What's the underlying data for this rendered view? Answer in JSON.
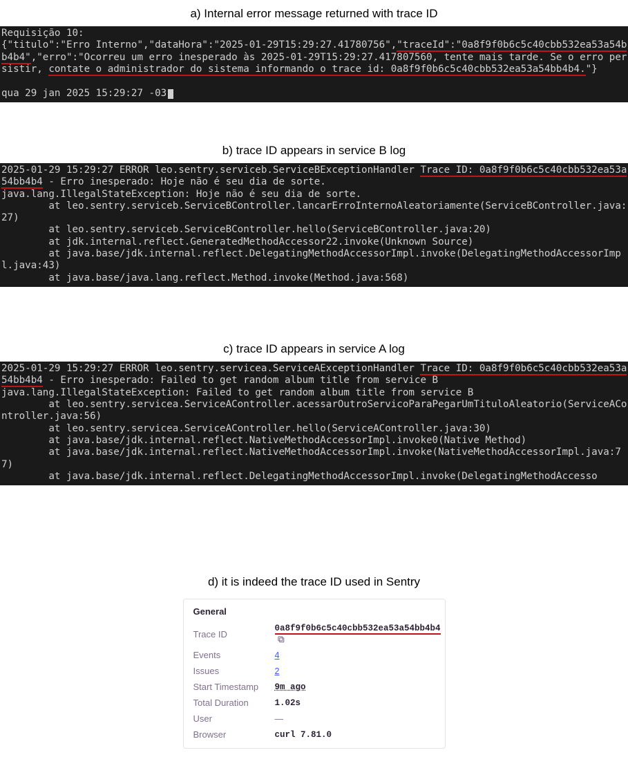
{
  "captions": {
    "a": "a) Internal error message returned with trace ID",
    "b": "b) trace ID appears in service B log",
    "c": "c) trace ID appears in service A log",
    "d": "d) it is indeed the trace ID used in Sentry"
  },
  "panelA": {
    "line1_pre": "Requisição 10:",
    "json_open": "{\"titulo\":\"Erro Interno\",\"dataHora\":\"2025-01-29T15:29:27.41780756\",",
    "json_trace_key": "\"traceId\":\"0a8f9f0b6c5c40cbb532ea53a54bb4b4\"",
    "json_mid": ",\"erro\":\"Ocorreu um erro inesperado às 2025-01-29T15:29:27.417807560, tente mais tarde. Se o erro persistir, ",
    "json_contact": "contate o administrador do sistema informando o trace id: 0a8f9f0b6c5c40cbb532ea53a54bb4b4.",
    "json_close": "\"}",
    "ts": "qua 29 jan 2025 15:29:27 -03"
  },
  "panelB": {
    "head_pre": "2025-01-29 15:29:27 ERROR leo.sentry.serviceb.ServiceBExceptionHandler ",
    "trace": "Trace ID: 0a8f9f0b6c5c40cbb532ea53a54bb4b4",
    "head_post": " - Erro inesperado: Hoje não é seu dia de sorte.",
    "stack": "java.lang.IllegalStateException: Hoje não é seu dia de sorte.\n        at leo.sentry.serviceb.ServiceBController.lancarErroInternoAleatoriamente(ServiceBController.java:27)\n        at leo.sentry.serviceb.ServiceBController.hello(ServiceBController.java:20)\n        at jdk.internal.reflect.GeneratedMethodAccessor22.invoke(Unknown Source)\n        at java.base/jdk.internal.reflect.DelegatingMethodAccessorImpl.invoke(DelegatingMethodAccessorImpl.java:43)\n        at java.base/java.lang.reflect.Method.invoke(Method.java:568)"
  },
  "panelC": {
    "head_pre": "2025-01-29 15:29:27 ERROR leo.sentry.servicea.ServiceAExceptionHandler ",
    "trace": "Trace ID: 0a8f9f0b6c5c40cbb532ea53a54bb4b4",
    "head_post": " - Erro inesperado: Failed to get random album title from service B",
    "stack": "java.lang.IllegalStateException: Failed to get random album title from service B\n        at leo.sentry.servicea.ServiceAController.acessarOutroServicoParaPegarUmTituloAleatorio(ServiceAController.java:56)\n        at leo.sentry.servicea.ServiceAController.hello(ServiceAController.java:30)\n        at java.base/jdk.internal.reflect.NativeMethodAccessorImpl.invoke0(Native Method)\n        at java.base/jdk.internal.reflect.NativeMethodAccessorImpl.invoke(NativeMethodAccessorImpl.java:77)\n        at java.base/jdk.internal.reflect.DelegatingMethodAccessorImpl.invoke(DelegatingMethodAccesso"
  },
  "sentry": {
    "title": "General",
    "rows": {
      "traceIdLabel": "Trace ID",
      "traceIdValue": "0a8f9f0b6c5c40cbb532ea53a54bb4b4",
      "eventsLabel": "Events",
      "eventsValue": "4",
      "issuesLabel": "Issues",
      "issuesValue": "2",
      "startLabel": "Start Timestamp",
      "startValue": "9m ago",
      "durationLabel": "Total Duration",
      "durationValue": "1.02s",
      "userLabel": "User",
      "userValue": "—",
      "browserLabel": "Browser",
      "browserValue": "curl 7.81.0"
    }
  }
}
